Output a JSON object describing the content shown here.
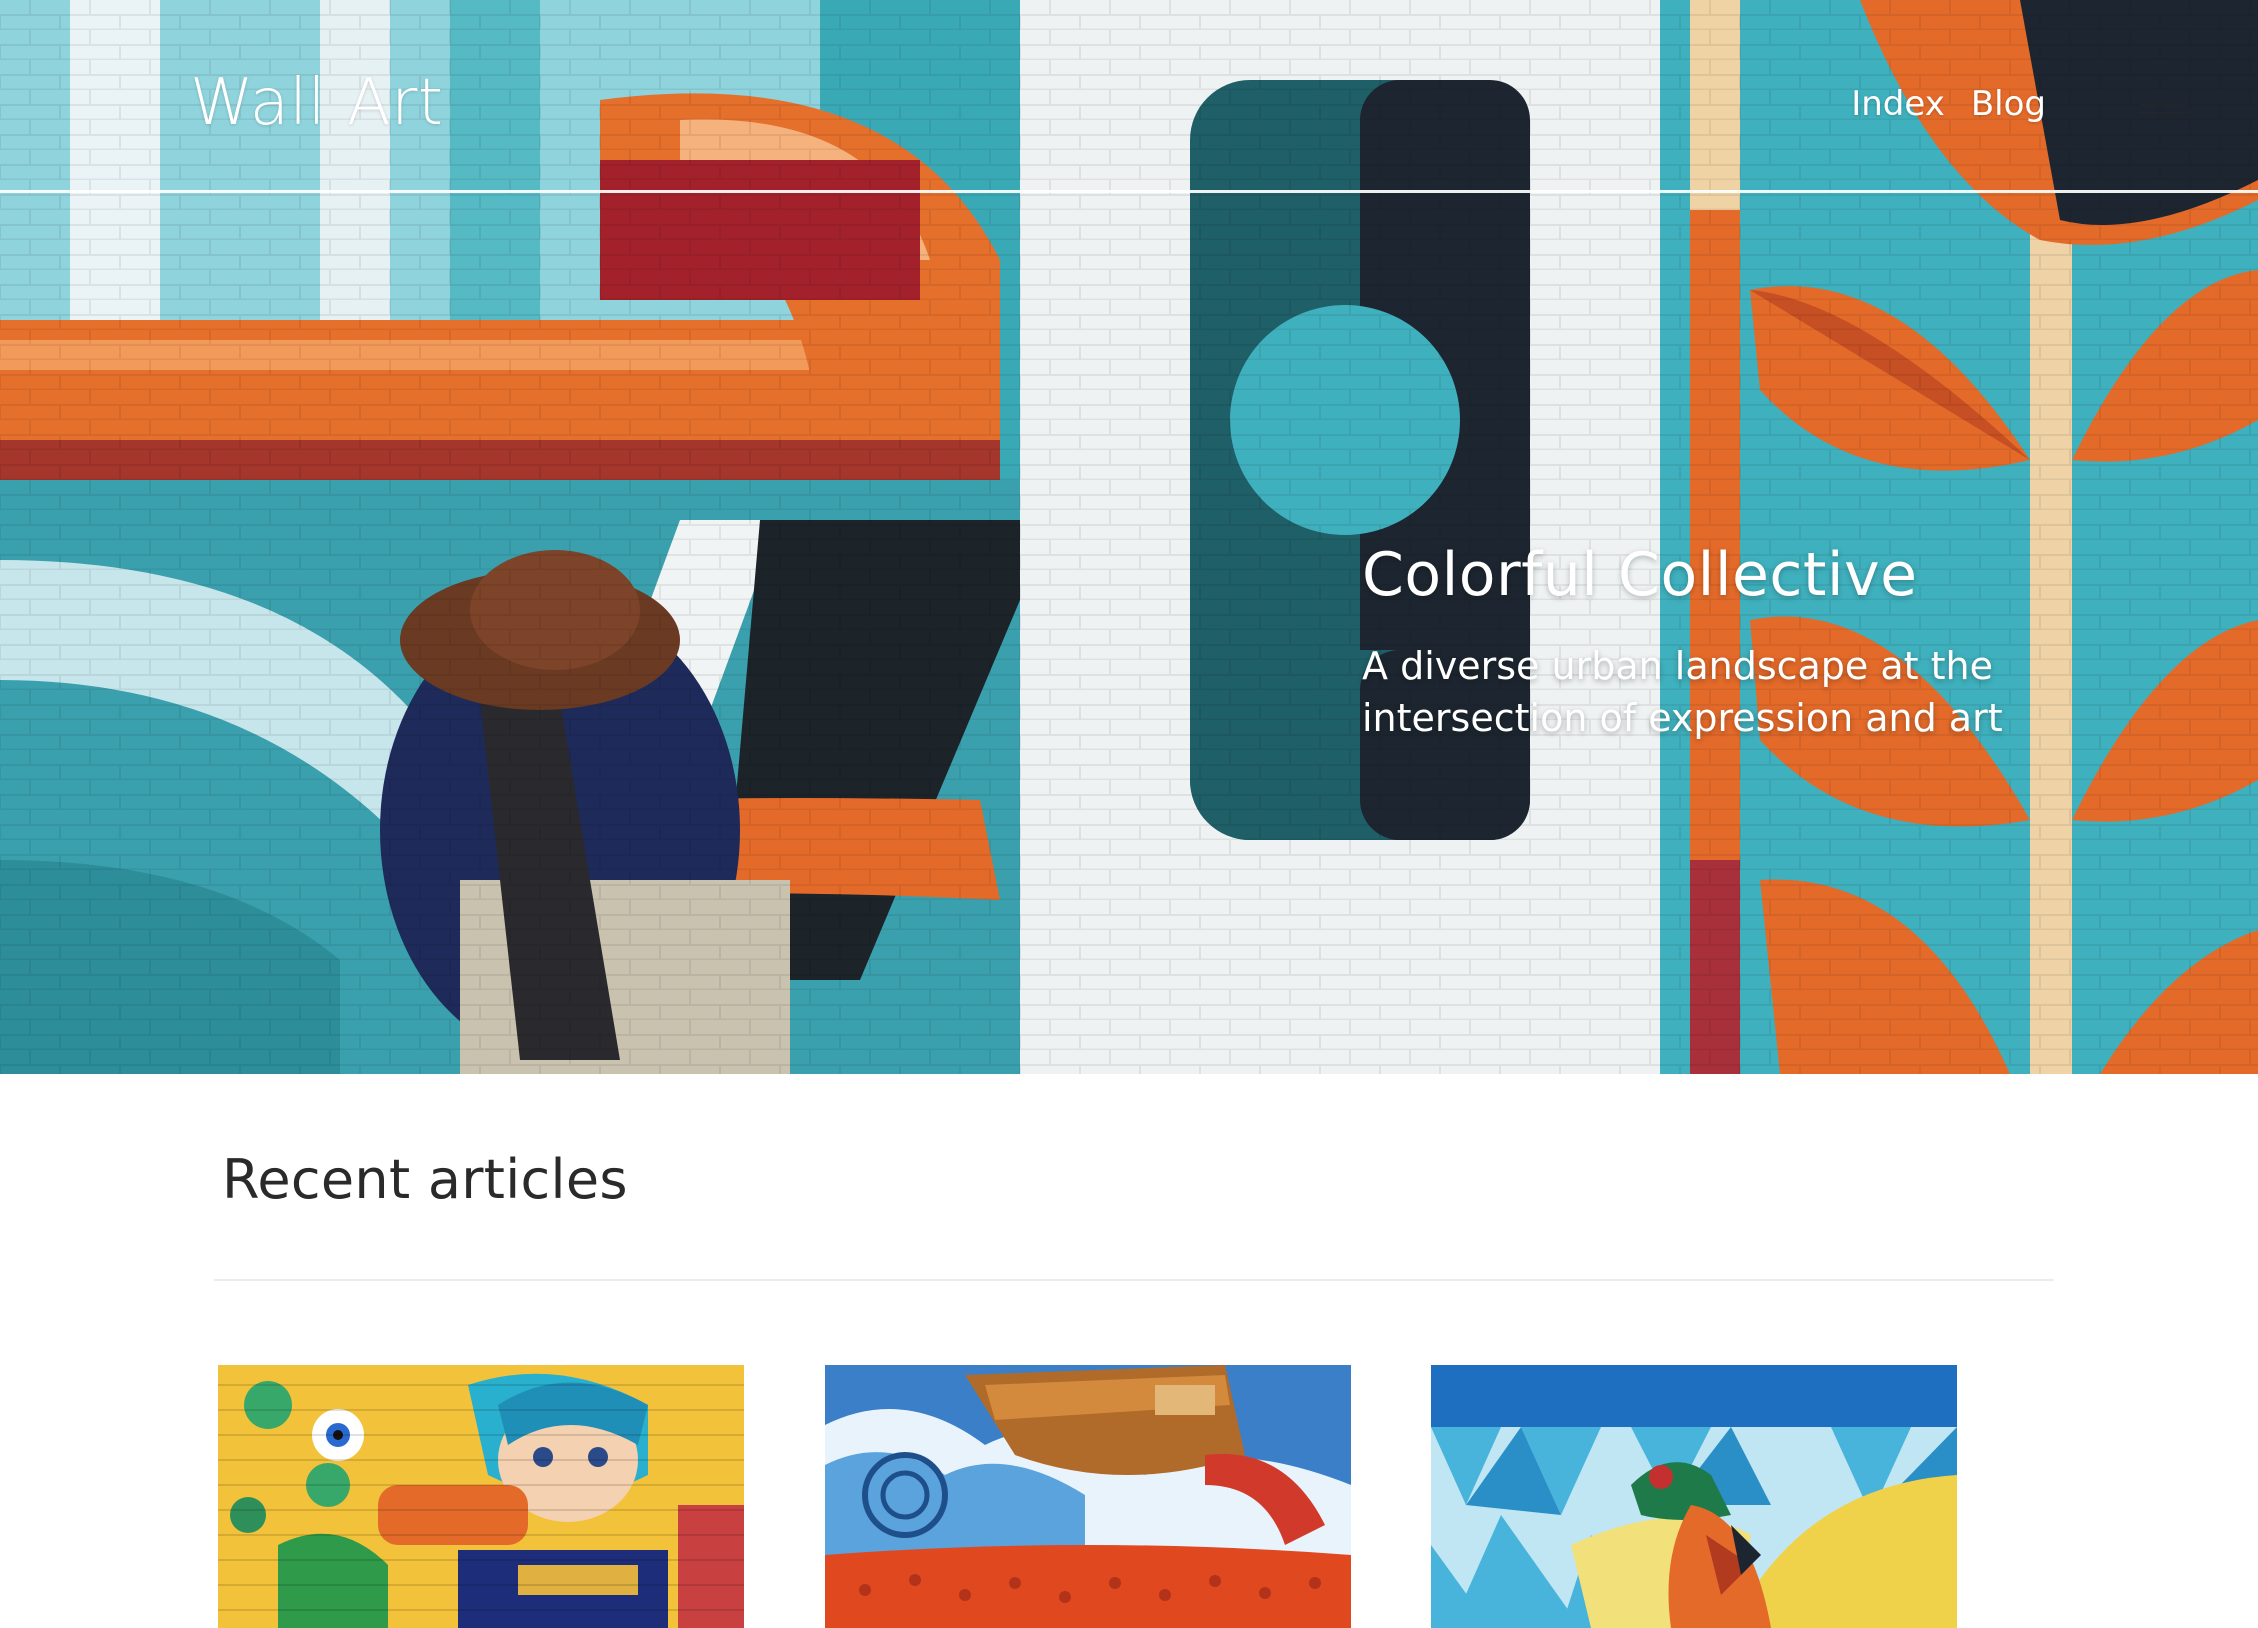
{
  "site": {
    "title": "Wall Art",
    "nav": [
      {
        "label": "Index"
      },
      {
        "label": "Blog"
      }
    ]
  },
  "hero": {
    "title": "Colorful Collective",
    "subtitle": "A diverse urban landscape at the intersection of expression and art"
  },
  "recent": {
    "heading": "Recent articles",
    "cards": [
      {
        "image": "mural-cartoon-girl-and-creatures"
      },
      {
        "image": "mural-ship-on-waves-with-orange-couch"
      },
      {
        "image": "mural-geometric-pheasant"
      }
    ]
  },
  "colors": {
    "teal": "#3fb0bd",
    "orange": "#e46a2a",
    "cream": "#f1d6a6",
    "dark": "#1d2630",
    "heading": "#2a2a2a"
  }
}
